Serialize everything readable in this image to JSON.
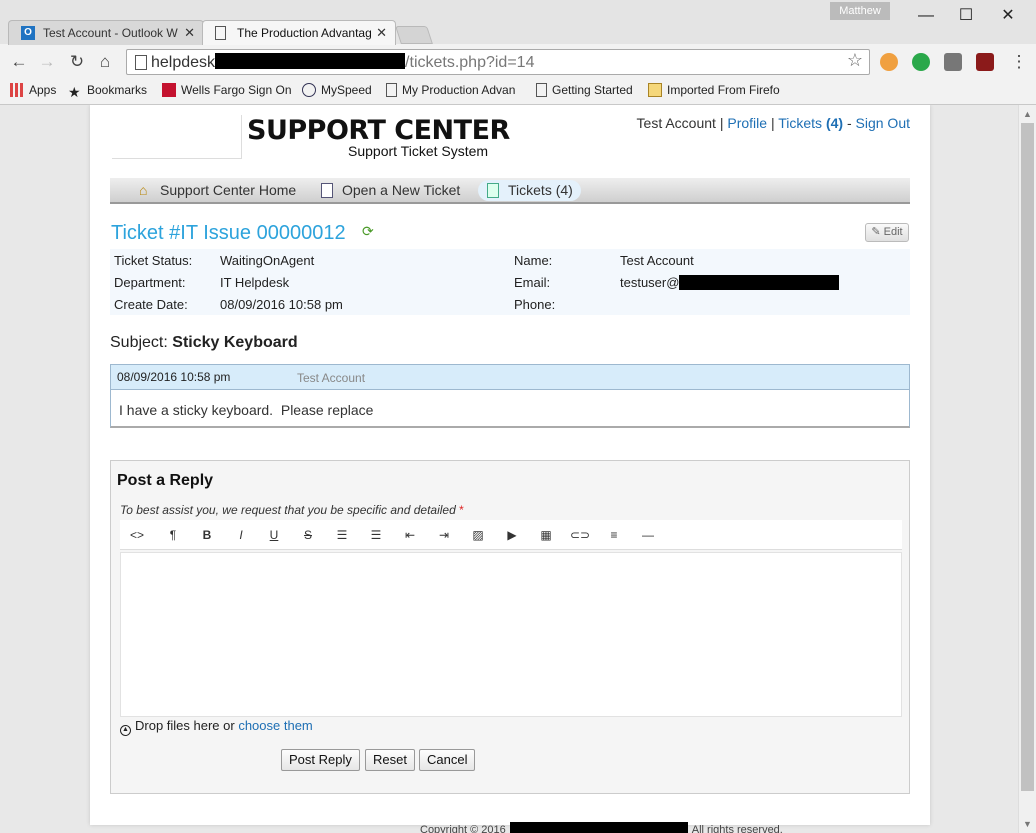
{
  "browser": {
    "user_badge": "Matthew",
    "tabs": [
      {
        "title": "Test Account - Outlook W"
      },
      {
        "title": "The Production Advantag"
      }
    ],
    "window_controls": {
      "minimize": "—",
      "maximize": "☐",
      "close": "✕"
    },
    "url_host_prefix": "helpdesk",
    "url_path": "/tickets.php?id=14",
    "bookmarks": [
      {
        "label": "Apps"
      },
      {
        "label": "Bookmarks"
      },
      {
        "label": "Wells Fargo Sign On"
      },
      {
        "label": "MySpeed"
      },
      {
        "label": "My Production Advan"
      },
      {
        "label": "Getting Started"
      },
      {
        "label": "Imported From Firefo"
      }
    ],
    "colors": {
      "tab_active": "#f6f6f6",
      "tab_inactive": "#d8d8d8"
    }
  },
  "header": {
    "logo_title": "SUPPORT CENTER",
    "logo_subtitle": "Support Ticket System",
    "user_name": "Test Account",
    "sep1": "|",
    "profile_link": "Profile",
    "sep2": "|",
    "tickets_link": "Tickets",
    "tickets_count": "(4)",
    "sep3": "-",
    "signout_link": "Sign Out"
  },
  "nav": {
    "items": [
      {
        "label": "Support Center Home",
        "icon": "home-icon"
      },
      {
        "label": "Open a New Ticket",
        "icon": "new-ticket-icon"
      },
      {
        "label": "Tickets (4)",
        "icon": "tickets-icon"
      }
    ]
  },
  "ticket": {
    "title": "Ticket #IT Issue 00000012",
    "edit_label": "Edit",
    "status_label": "Ticket Status:",
    "status_value": "WaitingOnAgent",
    "department_label": "Department:",
    "department_value": "IT Helpdesk",
    "create_date_label": "Create Date:",
    "create_date_value": "08/09/2016 10:58 pm",
    "name_label": "Name:",
    "name_value": "Test Account",
    "email_label": "Email:",
    "email_prefix": "testuser@",
    "phone_label": "Phone:",
    "phone_value": "",
    "subject_label": "Subject:",
    "subject_value": "Sticky Keyboard"
  },
  "thread": {
    "entries": [
      {
        "date": "08/09/2016 10:58 pm",
        "author": "Test Account",
        "body": "I have a sticky keyboard.  Please replace"
      }
    ]
  },
  "reply": {
    "title": "Post a Reply",
    "hint": "To best assist you, we request that you be specific and detailed",
    "required_mark": "*",
    "dropzone_text": "Drop files here or ",
    "dropzone_link": "choose them",
    "post_label": "Post Reply",
    "reset_label": "Reset",
    "cancel_label": "Cancel",
    "toolbar_buttons": [
      {
        "name": "html-icon",
        "glyph": "<>"
      },
      {
        "name": "paragraph-icon",
        "glyph": "¶"
      },
      {
        "name": "bold-icon",
        "glyph": "B"
      },
      {
        "name": "italic-icon",
        "glyph": "I"
      },
      {
        "name": "underline-icon",
        "glyph": "U"
      },
      {
        "name": "strikethrough-icon",
        "glyph": "S"
      },
      {
        "name": "unordered-list-icon",
        "glyph": "☰"
      },
      {
        "name": "ordered-list-icon",
        "glyph": "☰"
      },
      {
        "name": "outdent-icon",
        "glyph": "⇤"
      },
      {
        "name": "indent-icon",
        "glyph": "⇥"
      },
      {
        "name": "image-icon",
        "glyph": "▨"
      },
      {
        "name": "video-icon",
        "glyph": "▶"
      },
      {
        "name": "table-icon",
        "glyph": "▦"
      },
      {
        "name": "link-icon",
        "glyph": "⊂⊃"
      },
      {
        "name": "align-icon",
        "glyph": "≡"
      },
      {
        "name": "horizontal-rule-icon",
        "glyph": "—"
      }
    ]
  },
  "footer": {
    "prefix": "Copyright © 2016",
    "suffix": "All rights reserved."
  },
  "colors": {
    "link": "#1e6fb4",
    "ticket_title": "#2da3dc",
    "thread_header": "#d7ecfa",
    "info_bg": "#f3f8fd"
  }
}
